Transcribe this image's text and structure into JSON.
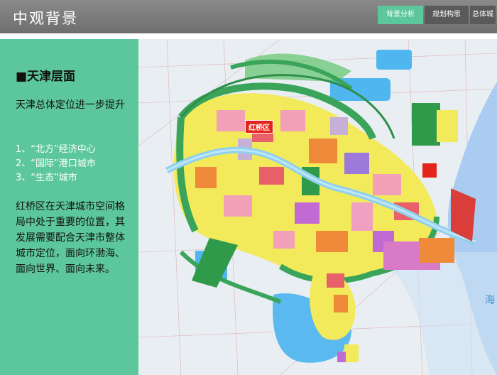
{
  "header": {
    "title": "中观背景",
    "tabs": [
      {
        "label": "背景分析",
        "active": true
      },
      {
        "label": "规划构思",
        "active": false
      },
      {
        "label": "总体城",
        "active": false
      }
    ]
  },
  "left_panel": {
    "heading": "■天津层面",
    "para1": "天津总体定位进一步提升",
    "list": [
      "1、“北方”经济中心",
      "2、“国际”港口城市",
      "3、“生态”城市"
    ],
    "para2": "红桥区在天津城市空间格局中处于重要的位置，其发展需要配合天津市整体城市定位，面向环渤海、面向世界、面向未来。"
  },
  "map": {
    "district_label": "红桥区",
    "sea_label": "海"
  },
  "colors": {
    "accent": "#5cc79a",
    "header": "#787878",
    "highlight": "#e3241b"
  }
}
